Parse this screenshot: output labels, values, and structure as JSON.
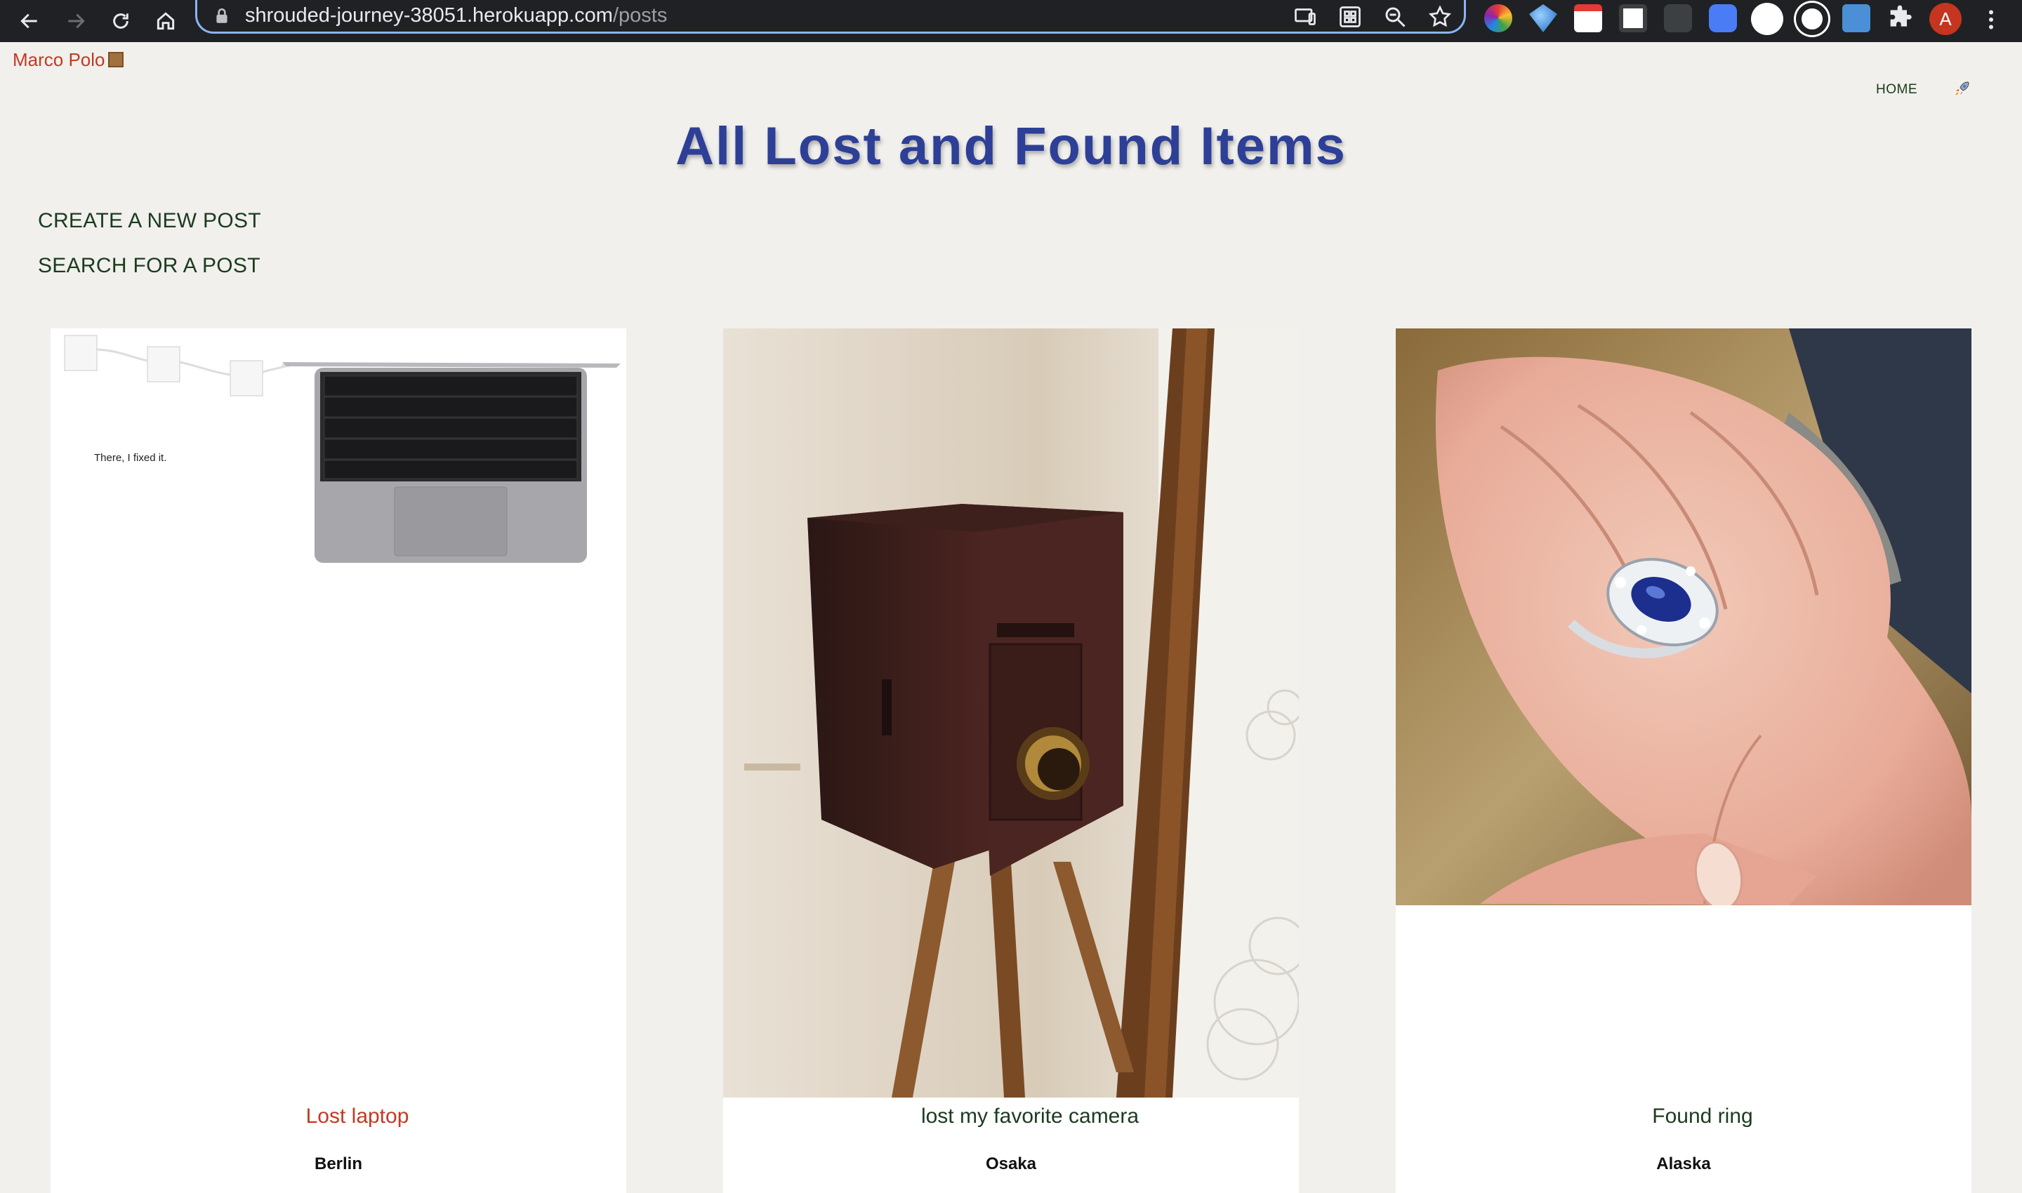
{
  "browser": {
    "url_host": "shrouded-journey-38051.herokuapp.com",
    "url_path": "/posts",
    "profile_initial": "A"
  },
  "site": {
    "brand": "Marco Polo",
    "nav_home": "HOME"
  },
  "page": {
    "title": "All Lost and Found Items",
    "actions": [
      "CREATE A NEW POST",
      "SEARCH FOR A POST"
    ]
  },
  "posts": [
    {
      "title": "Lost laptop",
      "location": "Berlin",
      "image": "laptop-photo",
      "image_caption": "There, I fixed it.",
      "title_color": "#c33a22"
    },
    {
      "title": "lost my favorite camera",
      "location": "Osaka",
      "image": "camera-photo",
      "title_color": "#1c3b20"
    },
    {
      "title": "Found ring",
      "location": "Alaska",
      "image": "ring-photo",
      "title_color": "#1c3b20"
    }
  ],
  "colors": {
    "page_background": "#f1f0ec",
    "title_blue": "#2d3f96",
    "link_green": "#1c3b20",
    "brand_red": "#c33a22"
  }
}
